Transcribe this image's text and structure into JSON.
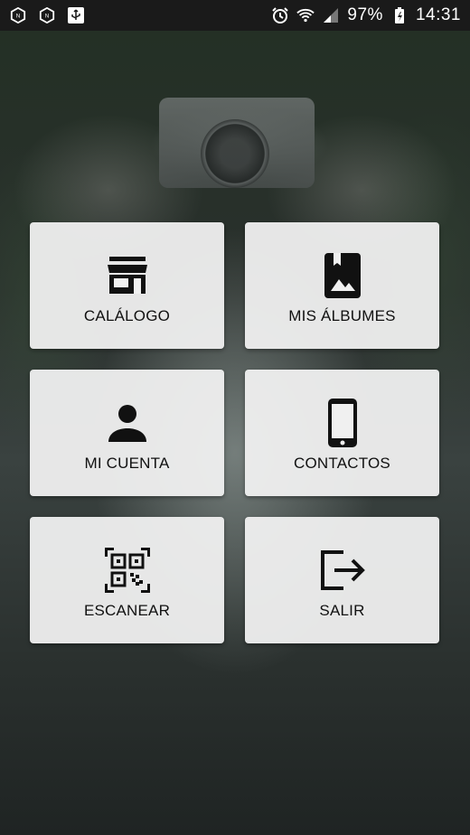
{
  "status_bar": {
    "battery": "97%",
    "time": "14:31",
    "icons": [
      "app-notification-icon",
      "app-notification-icon",
      "usb-icon",
      "alarm-icon",
      "wifi-icon",
      "signal-icon",
      "battery-charging-icon"
    ]
  },
  "menu": {
    "catalogo": "CALÁLOGO",
    "albumes": "MIS ÁLBUMES",
    "cuenta": "MI CUENTA",
    "contactos": "CONTACTOS",
    "escanear": "ESCANEAR",
    "salir": "SALIR"
  },
  "colors": {
    "tile_bg": "#f0f0f0",
    "icon": "#111111",
    "status_bar": "#1a1a1a"
  }
}
